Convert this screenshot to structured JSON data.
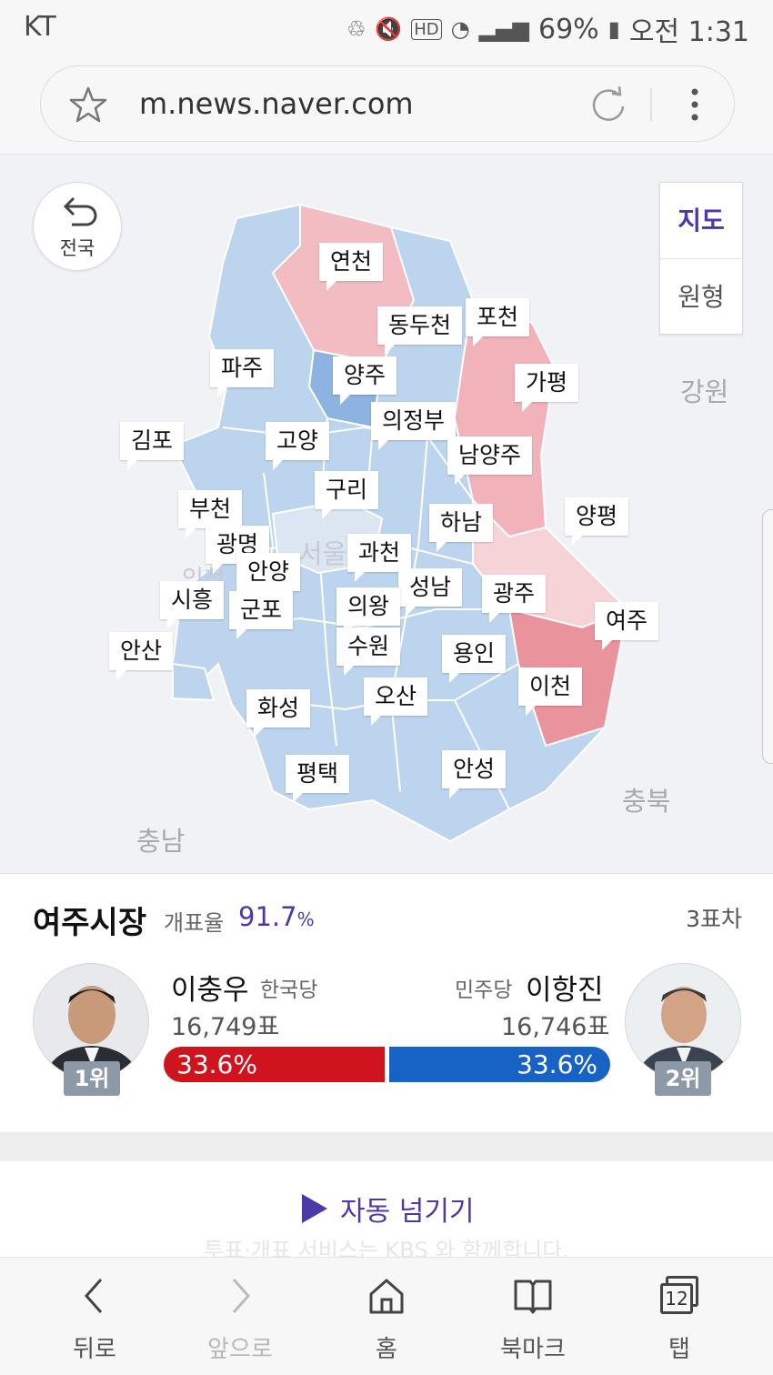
{
  "status_bar": {
    "carrier": "KT",
    "battery": "69%",
    "time": "오전 1:31"
  },
  "browser": {
    "url": "m.news.naver.com"
  },
  "map": {
    "back_label": "전국",
    "view_toggle": [
      "지도",
      "원형"
    ],
    "regions": [
      "연천",
      "동두천",
      "포천",
      "파주",
      "양주",
      "가평",
      "김포",
      "고양",
      "의정부",
      "남양주",
      "구리",
      "부천",
      "하남",
      "양평",
      "광명",
      "서울",
      "과천",
      "인천",
      "안양",
      "성남",
      "광주",
      "시흥",
      "군포",
      "의왕",
      "여주",
      "안산",
      "수원",
      "용인",
      "이천",
      "화성",
      "오산",
      "평택",
      "안성"
    ],
    "neighbors": {
      "gangwon": "강원",
      "chungbuk": "충북",
      "chungnam": "충남"
    }
  },
  "result": {
    "title": "여주시장",
    "count_label": "개표율",
    "count_rate": "91.7",
    "count_unit": "%",
    "diff": "3표차",
    "candidates": [
      {
        "name": "이충우",
        "party": "한국당",
        "votes": "16,749표",
        "percent": "33.6%",
        "rank": "1위",
        "color": "#d0141e"
      },
      {
        "name": "이항진",
        "party": "민주당",
        "votes": "16,746표",
        "percent": "33.6%",
        "rank": "2위",
        "color": "#1762c5"
      }
    ]
  },
  "auto_advance": {
    "label": "자동 넘기기",
    "footer": "투표·개표 서비스는 KBS 와 함께합니다."
  },
  "bottom_nav": {
    "back": "뒤로",
    "forward": "앞으로",
    "home": "홈",
    "bookmark": "북마크",
    "tabs": "탭",
    "tab_count": "12"
  }
}
